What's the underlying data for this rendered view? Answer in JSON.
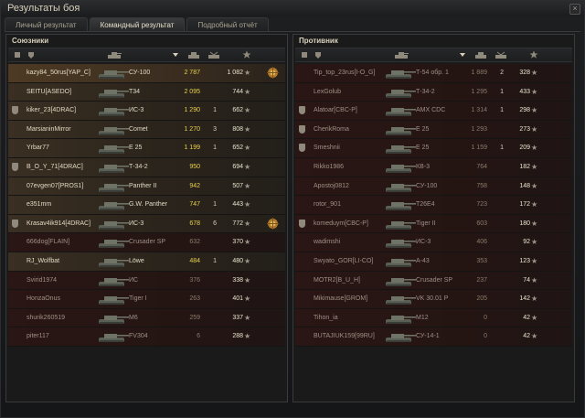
{
  "window": {
    "title": "Результаты боя"
  },
  "tabs": [
    {
      "label": "Личный результат",
      "active": false
    },
    {
      "label": "Командный результат",
      "active": true
    },
    {
      "label": "Подробный отчёт",
      "active": false
    }
  ],
  "icons": {
    "header": [
      "squad-icon",
      "clan-icon",
      "tank-icon",
      "sort-arrow-icon",
      "damage-icon",
      "frags-icon",
      "star-icon"
    ],
    "row": [
      "clan-emblem-icon",
      "tank-icon",
      "star-icon",
      "medal-icon"
    ]
  },
  "colors": {
    "damage": "#e8d14a",
    "alive_row": "#3a2f22",
    "dead_row": "#2a1614",
    "highlight_row": "#4e3a24"
  },
  "allies": {
    "title": "Союзники",
    "rows": [
      {
        "player": "kazy84_50rus[YAP_C]",
        "tank": "СУ-100",
        "damage": "2 787",
        "frags": "",
        "exp": "1 082",
        "star": "★",
        "medal": true,
        "clan": false,
        "state": "highlight"
      },
      {
        "player": "SEITU[ASEDO]",
        "tank": "T34",
        "damage": "2 095",
        "frags": "",
        "exp": "744",
        "star": "★",
        "medal": false,
        "clan": false,
        "state": "alive"
      },
      {
        "player": "kiker_23[4DRAC]",
        "tank": "ИС-3",
        "damage": "1 290",
        "frags": "1",
        "exp": "662",
        "star": "★",
        "medal": false,
        "clan": true,
        "state": "alive"
      },
      {
        "player": "MarsianinMirror",
        "tank": "Comet",
        "damage": "1 270",
        "frags": "3",
        "exp": "808",
        "star": "★",
        "medal": false,
        "clan": false,
        "state": "alive"
      },
      {
        "player": "Yrbar77",
        "tank": "E 25",
        "damage": "1 199",
        "frags": "1",
        "exp": "652",
        "star": "★",
        "medal": false,
        "clan": false,
        "state": "alive"
      },
      {
        "player": "B_O_Y_71[4DRAC]",
        "tank": "Т-34-2",
        "damage": "950",
        "frags": "",
        "exp": "694",
        "star": "★",
        "medal": false,
        "clan": true,
        "state": "alive"
      },
      {
        "player": "07evgen07[PROS1]",
        "tank": "Panther II",
        "damage": "942",
        "frags": "",
        "exp": "507",
        "star": "★",
        "medal": false,
        "clan": false,
        "state": "alive"
      },
      {
        "player": "e351mm",
        "tank": "G.W. Panther",
        "damage": "747",
        "frags": "1",
        "exp": "443",
        "star": "★",
        "medal": false,
        "clan": false,
        "state": "alive"
      },
      {
        "player": "Krasav4ik914[4DRAC]",
        "tank": "ИС-3",
        "damage": "678",
        "frags": "6",
        "exp": "772",
        "star": "★",
        "medal": true,
        "clan": true,
        "state": "alive"
      },
      {
        "player": "666dog[FLAIN]",
        "tank": "Crusader SP",
        "damage": "632",
        "frags": "",
        "exp": "370",
        "star": "★",
        "medal": false,
        "clan": false,
        "state": "dead"
      },
      {
        "player": "RJ_Wolfbat",
        "tank": "Löwe",
        "damage": "484",
        "frags": "1",
        "exp": "480",
        "star": "★",
        "medal": false,
        "clan": false,
        "state": "alive"
      },
      {
        "player": "Svirid1974",
        "tank": "ИС",
        "damage": "376",
        "frags": "",
        "exp": "338",
        "star": "★",
        "medal": false,
        "clan": false,
        "state": "dead"
      },
      {
        "player": "HonzaOnus",
        "tank": "Tiger I",
        "damage": "263",
        "frags": "",
        "exp": "401",
        "star": "★",
        "medal": false,
        "clan": false,
        "state": "dead"
      },
      {
        "player": "shurik260519",
        "tank": "M6",
        "damage": "259",
        "frags": "",
        "exp": "337",
        "star": "★",
        "medal": false,
        "clan": false,
        "state": "dead"
      },
      {
        "player": "piter117",
        "tank": "FV304",
        "damage": "6",
        "frags": "",
        "exp": "288",
        "star": "★",
        "medal": false,
        "clan": false,
        "state": "dead"
      }
    ]
  },
  "enemies": {
    "title": "Противник",
    "rows": [
      {
        "player": "Tip_top_23rus[I-O_G]",
        "tank": "Т-54 обр. 1",
        "damage": "1 889",
        "frags": "2",
        "exp": "328",
        "star": "★",
        "medal": false,
        "clan": false,
        "state": "dead"
      },
      {
        "player": "LexGolub",
        "tank": "Т-34-2",
        "damage": "1 295",
        "frags": "1",
        "exp": "433",
        "star": "★",
        "medal": false,
        "clan": false,
        "state": "dead"
      },
      {
        "player": "Alatoar[CBC-P]",
        "tank": "AMX CDC",
        "damage": "1 314",
        "frags": "1",
        "exp": "298",
        "star": "★",
        "medal": false,
        "clan": true,
        "state": "dead"
      },
      {
        "player": "CherikRoma",
        "tank": "E 25",
        "damage": "1 293",
        "frags": "",
        "exp": "273",
        "star": "★",
        "medal": false,
        "clan": true,
        "state": "dead"
      },
      {
        "player": "Smeshnii",
        "tank": "E 25",
        "damage": "1 159",
        "frags": "1",
        "exp": "209",
        "star": "★",
        "medal": false,
        "clan": true,
        "state": "dead"
      },
      {
        "player": "Rikko1986",
        "tank": "КВ-3",
        "damage": "764",
        "frags": "",
        "exp": "182",
        "star": "★",
        "medal": false,
        "clan": false,
        "state": "dead"
      },
      {
        "player": "Apostoj0812",
        "tank": "СУ-100",
        "damage": "758",
        "frags": "",
        "exp": "148",
        "star": "★",
        "medal": false,
        "clan": false,
        "state": "dead"
      },
      {
        "player": "rotor_901",
        "tank": "T26E4",
        "damage": "723",
        "frags": "",
        "exp": "172",
        "star": "★",
        "medal": false,
        "clan": false,
        "state": "dead"
      },
      {
        "player": "komeduym[CBC-P]",
        "tank": "Tiger II",
        "damage": "603",
        "frags": "",
        "exp": "180",
        "star": "★",
        "medal": false,
        "clan": true,
        "state": "dead"
      },
      {
        "player": "wadimshi",
        "tank": "ИС-3",
        "damage": "406",
        "frags": "",
        "exp": "92",
        "star": "★",
        "medal": false,
        "clan": false,
        "state": "dead"
      },
      {
        "player": "Swyato_GOR[LI-CO]",
        "tank": "A-43",
        "damage": "353",
        "frags": "",
        "exp": "123",
        "star": "★",
        "medal": false,
        "clan": false,
        "state": "dead"
      },
      {
        "player": "MOTR2[B_U_H]",
        "tank": "Crusader SP",
        "damage": "237",
        "frags": "",
        "exp": "74",
        "star": "★",
        "medal": false,
        "clan": false,
        "state": "dead"
      },
      {
        "player": "Mikimause[GROM]",
        "tank": "VK 30.01 P",
        "damage": "205",
        "frags": "",
        "exp": "142",
        "star": "★",
        "medal": false,
        "clan": false,
        "state": "dead"
      },
      {
        "player": "Tihon_ia",
        "tank": "M12",
        "damage": "0",
        "frags": "",
        "exp": "42",
        "star": "★",
        "medal": false,
        "clan": false,
        "state": "dead"
      },
      {
        "player": "BUTAJIUK159[99RU]",
        "tank": "СУ-14-1",
        "damage": "0",
        "frags": "",
        "exp": "42",
        "star": "★",
        "medal": false,
        "clan": false,
        "state": "dead"
      }
    ]
  }
}
